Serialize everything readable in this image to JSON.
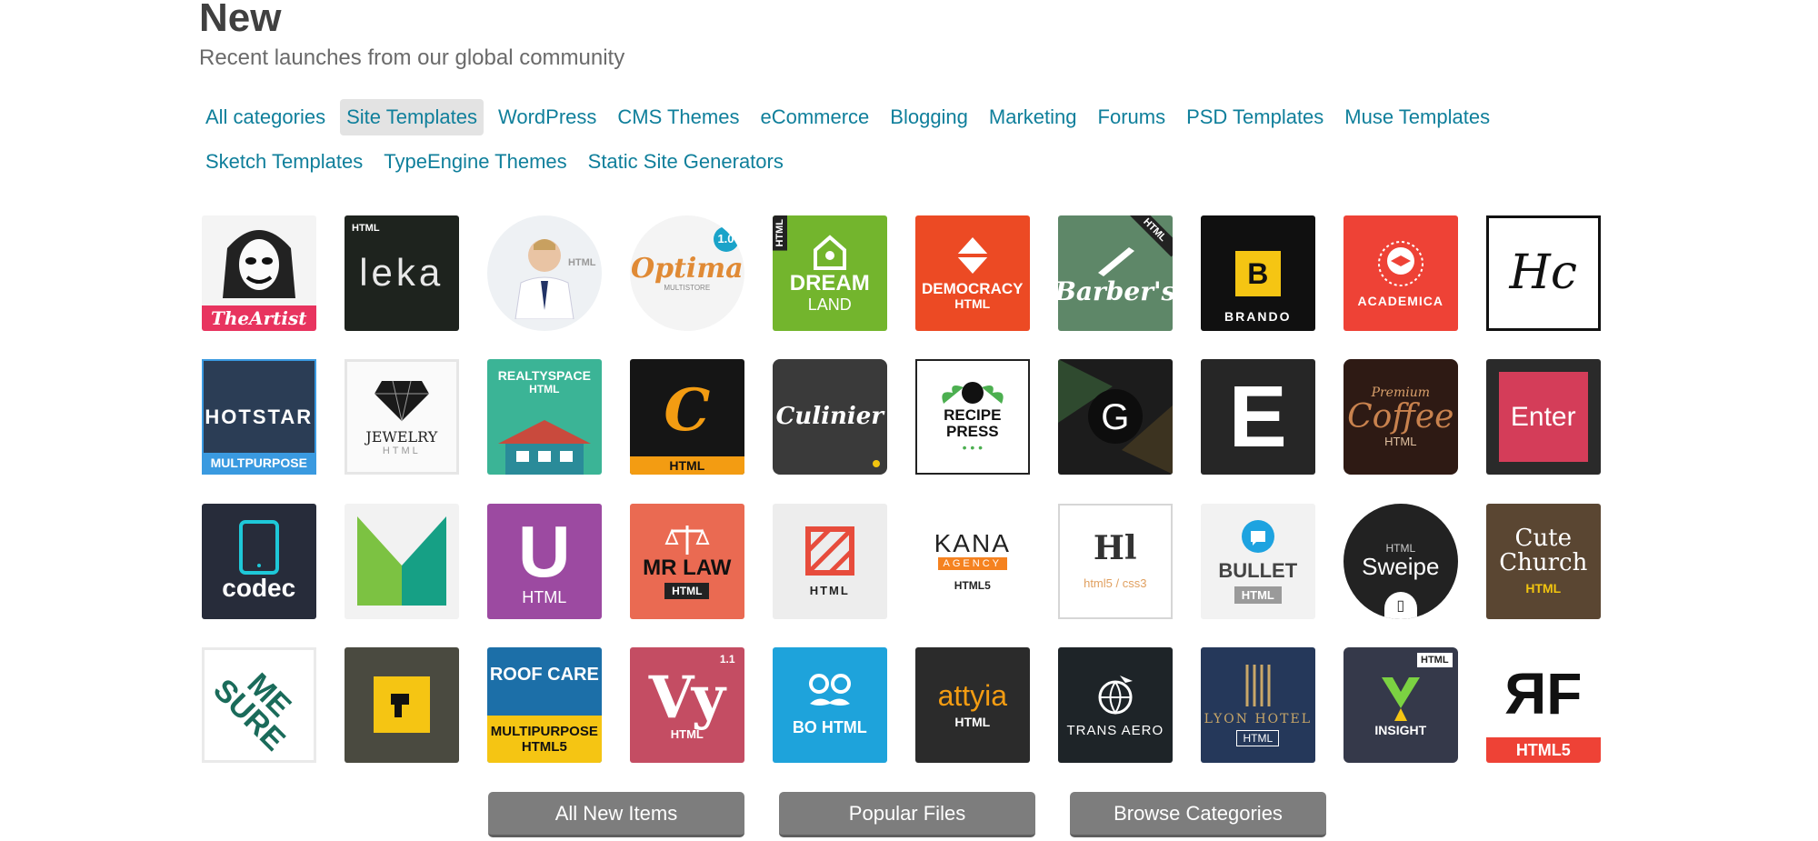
{
  "header": {
    "title": "New",
    "subtitle": "Recent launches from our global community"
  },
  "categories": {
    "row1": [
      "All categories",
      "Site Templates",
      "WordPress",
      "CMS Themes",
      "eCommerce",
      "Blogging",
      "Marketing",
      "Forums",
      "PSD Templates",
      "Muse Templates"
    ],
    "row2": [
      "Sketch Templates",
      "TypeEngine Themes",
      "Static Site Generators"
    ],
    "active": "Site Templates"
  },
  "tiles": {
    "r1": [
      {
        "main": "TheArtist",
        "sub": ""
      },
      {
        "main": "leka",
        "sub": "",
        "tag": "HTML"
      },
      {
        "main": "",
        "sub": "HTML"
      },
      {
        "main": "Optima",
        "sub": "MULTISTORE",
        "tag": "1.0"
      },
      {
        "main": "DREAM",
        "sub": "LAND",
        "tag": "HTML"
      },
      {
        "main": "DEMOCRACY",
        "sub": "HTML"
      },
      {
        "main": "Barber's",
        "sub": "",
        "tag": "HTML"
      },
      {
        "main": "B",
        "sub": "BRANDO"
      },
      {
        "main": "",
        "sub": "ACADEMICA"
      },
      {
        "main": "Hc",
        "sub": ""
      }
    ],
    "r2": [
      {
        "main": "HOTSTAR",
        "sub": "MULTPURPOSE"
      },
      {
        "main": "JEWELRY",
        "sub": "HTML"
      },
      {
        "main": "REALTYSPACE",
        "sub": "HTML"
      },
      {
        "main": "C",
        "sub": "HTML"
      },
      {
        "main": "Culinier",
        "sub": ""
      },
      {
        "main": "RECIPE PRESS",
        "sub": ""
      },
      {
        "main": "G",
        "sub": ""
      },
      {
        "main": "E",
        "sub": ""
      },
      {
        "main": "Coffee",
        "sub": "HTML",
        "tag": "Premium"
      },
      {
        "main": "Enter",
        "sub": ""
      }
    ],
    "r3": [
      {
        "main": "codec",
        "sub": ""
      },
      {
        "main": "",
        "sub": ""
      },
      {
        "main": "U",
        "sub": "HTML"
      },
      {
        "main": "MR LAW",
        "sub": "HTML"
      },
      {
        "main": "",
        "sub": "HTML"
      },
      {
        "main": "KANA",
        "sub": "HTML5",
        "tag": "AGENCY"
      },
      {
        "main": "Hl",
        "sub": "html5 / css3"
      },
      {
        "main": "BULLET",
        "sub": "HTML"
      },
      {
        "main": "Sweipe",
        "sub": "",
        "tag": "HTML"
      },
      {
        "main": "Cute Church",
        "sub": "HTML"
      }
    ],
    "r4": [
      {
        "main": "ME SURE",
        "sub": ""
      },
      {
        "main": "",
        "sub": ""
      },
      {
        "main": "ROOF CARE",
        "sub": "MULTIPURPOSE HTML5"
      },
      {
        "main": "Vy",
        "sub": "HTML",
        "tag": "1.1"
      },
      {
        "main": "",
        "sub": "BO HTML"
      },
      {
        "main": "attyia",
        "sub": "HTML"
      },
      {
        "main": "",
        "sub": "TRANS AERO"
      },
      {
        "main": "",
        "sub": "LYON HOTEL",
        "tag": "HTML"
      },
      {
        "main": "",
        "sub": "INSIGHT",
        "tag": "HTML"
      },
      {
        "main": "ЯF",
        "sub": "HTML5"
      }
    ]
  },
  "buttons": {
    "all_new": "All New Items",
    "popular": "Popular Files",
    "browse": "Browse Categories"
  }
}
